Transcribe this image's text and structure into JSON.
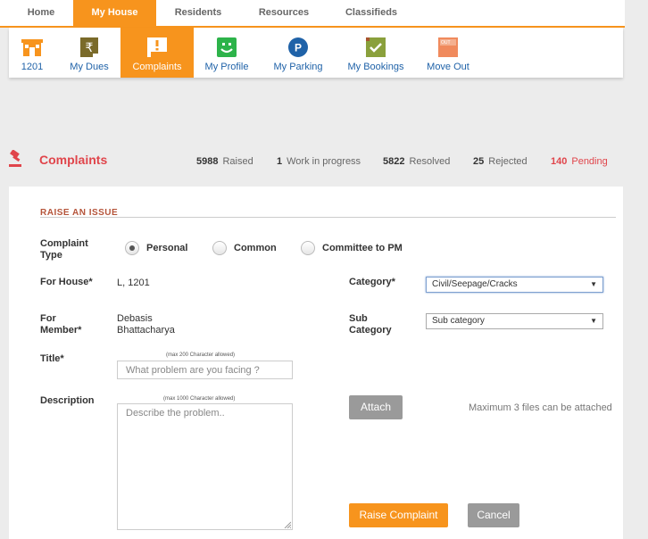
{
  "topnav": {
    "tabs": [
      {
        "label": "Home"
      },
      {
        "label": "My House"
      },
      {
        "label": "Residents"
      },
      {
        "label": "Resources"
      },
      {
        "label": "Classifieds"
      }
    ],
    "active": "My House"
  },
  "subnav": {
    "items": [
      {
        "label": "1201",
        "icon": "house-icon"
      },
      {
        "label": "My Dues",
        "icon": "rupee-bill-icon"
      },
      {
        "label": "Complaints",
        "icon": "alert-flag-icon"
      },
      {
        "label": "My Profile",
        "icon": "smiley-icon"
      },
      {
        "label": "My Parking",
        "icon": "parking-icon"
      },
      {
        "label": "My Bookings",
        "icon": "checklist-icon"
      },
      {
        "label": "Move Out",
        "icon": "move-out-sign-icon"
      }
    ],
    "active": "Complaints",
    "moveout_sign": "OUT"
  },
  "complaints": {
    "title": "Complaints",
    "stats": [
      {
        "count": "5988",
        "label": "Raised"
      },
      {
        "count": "1",
        "label": "Work in progress"
      },
      {
        "count": "5822",
        "label": "Resolved"
      },
      {
        "count": "25",
        "label": "Rejected"
      },
      {
        "count": "140",
        "label": "Pending"
      }
    ]
  },
  "form": {
    "section_title": "RAISE AN ISSUE",
    "complaint_type_label_1": "Complaint",
    "complaint_type_label_2": "Type",
    "types": [
      "Personal",
      "Common",
      "Committee to PM"
    ],
    "selected_type": "Personal",
    "for_house_label": "For House*",
    "for_house_value": "L, 1201",
    "for_member_label_1": "For",
    "for_member_label_2": "Member*",
    "member_first": "Debasis",
    "member_last": "Bhattacharya",
    "category_label": "Category*",
    "category_value": "Civil/Seepage/Cracks",
    "sub_category_label_1": "Sub",
    "sub_category_label_2": "Category",
    "sub_category_value": "Sub category",
    "title_label": "Title*",
    "title_hint": "(max 200 Character allowed)",
    "title_placeholder": "What problem are you facing ?",
    "description_label": "Description",
    "description_hint": "(max 1000 Character allowed)",
    "description_placeholder": "Describe the problem..",
    "attach_label": "Attach",
    "attach_note": "Maximum 3 files can be attached",
    "raise_label": "Raise Complaint",
    "cancel_label": "Cancel"
  },
  "colors": {
    "accent": "#f7941d",
    "alert": "#e0454b",
    "link": "#1f62a8"
  }
}
